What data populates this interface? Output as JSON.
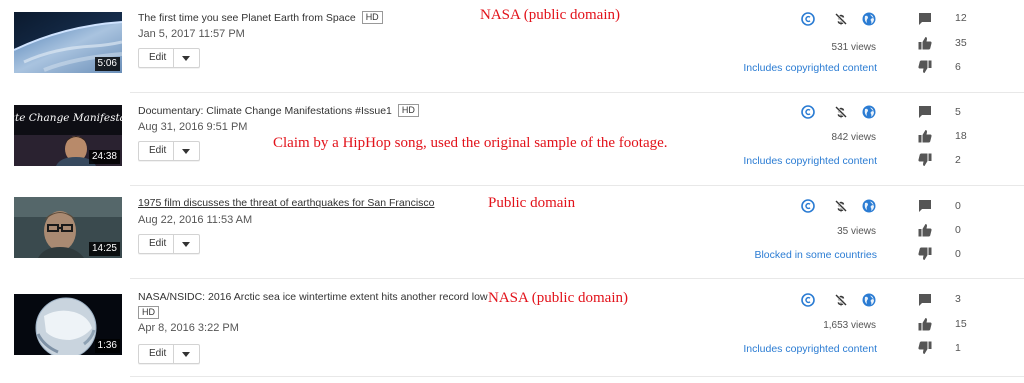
{
  "videos": [
    {
      "title": "The first time you see Planet Earth from Space",
      "hd": "HD",
      "date": "Jan 5, 2017 11:57 PM",
      "duration": "5:06",
      "edit_label": "Edit",
      "annotation": "NASA (public domain)",
      "views": "531 views",
      "status": "Includes copyrighted content",
      "comments": "12",
      "likes": "35",
      "dislikes": "6"
    },
    {
      "title": "Documentary: Climate Change Manifestations #Issue1",
      "hd": "HD",
      "date": "Aug 31, 2016 9:51 PM",
      "duration": "24:38",
      "thumb_text": "Climate Change Manifestations",
      "edit_label": "Edit",
      "annotation": "Claim by a HipHop song, used the original sample of the footage.",
      "views": "842 views",
      "status": "Includes copyrighted content",
      "comments": "5",
      "likes": "18",
      "dislikes": "2"
    },
    {
      "title": "1975 film discusses the threat of earthquakes for San Francisco",
      "date": "Aug 22, 2016 11:53 AM",
      "duration": "14:25",
      "edit_label": "Edit",
      "annotation": "Public domain",
      "views": "35 views",
      "status": "Blocked in some countries",
      "comments": "0",
      "likes": "0",
      "dislikes": "0"
    },
    {
      "title": "NASA/NSIDC: 2016 Arctic sea ice wintertime extent hits another record low",
      "hd": "HD",
      "date": "Apr 8, 2016 3:22 PM",
      "duration": "1:36",
      "edit_label": "Edit",
      "annotation": "NASA (public domain)",
      "views": "1,653 views",
      "status": "Includes copyrighted content",
      "comments": "3",
      "likes": "15",
      "dislikes": "1"
    }
  ],
  "icons": {
    "copyright": "copyright-icon",
    "monetization": "monetization-off-icon",
    "visibility": "public-globe-icon",
    "comments": "comment-icon",
    "likes": "thumbs-up-icon",
    "dislikes": "thumbs-down-icon"
  },
  "colors": {
    "link_blue": "#2b7cd3",
    "annotation_red": "#e2121a",
    "icon_gray": "#555555"
  }
}
